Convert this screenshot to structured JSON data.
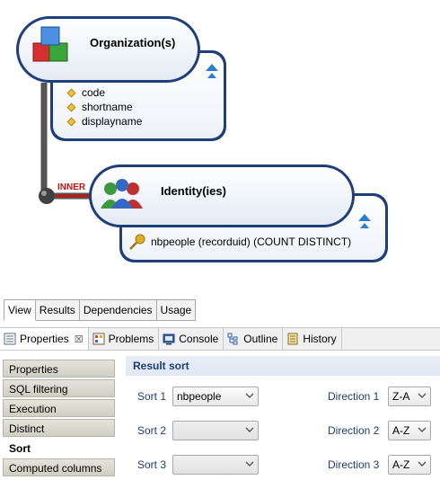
{
  "diagram": {
    "node1": {
      "title": "Organization(s)",
      "fields": [
        "code",
        "shortname",
        "displayname"
      ]
    },
    "join": {
      "type": "INNER"
    },
    "node2": {
      "title": "Identity(ies)",
      "fields": [
        "nbpeople (recorduid) (COUNT DISTINCT)"
      ]
    }
  },
  "view_tabs": [
    "View",
    "Results",
    "Dependencies",
    "Usage"
  ],
  "panel_tabs": [
    {
      "label": "Properties",
      "icon": "properties-icon"
    },
    {
      "label": "Problems",
      "icon": "problems-icon"
    },
    {
      "label": "Console",
      "icon": "console-icon"
    },
    {
      "label": "Outline",
      "icon": "outline-icon"
    },
    {
      "label": "History",
      "icon": "history-icon"
    }
  ],
  "left_nav": [
    "Properties",
    "SQL filtering",
    "Execution",
    "Distinct",
    "Sort",
    "Computed columns"
  ],
  "left_nav_selected": "Sort",
  "result_sort": {
    "header": "Result sort",
    "rows": [
      {
        "sort_label": "Sort 1",
        "sort_value": "nbpeople",
        "dir_label": "Direction 1",
        "dir_value": "Z-A"
      },
      {
        "sort_label": "Sort 2",
        "sort_value": "",
        "dir_label": "Direction 2",
        "dir_value": "A-Z"
      },
      {
        "sort_label": "Sort 3",
        "sort_value": "",
        "dir_label": "Direction 3",
        "dir_value": "A-Z"
      }
    ]
  }
}
